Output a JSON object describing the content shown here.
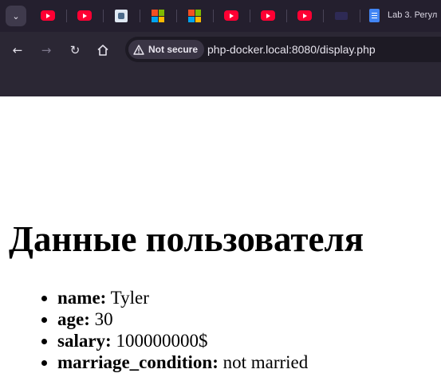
{
  "browser": {
    "active_tab": {
      "title": "Lab 3. Регул",
      "icon": "google-docs-icon"
    },
    "tab_icons": [
      "youtube-icon",
      "youtube-icon",
      "extension-icon",
      "microsoft-icon",
      "microsoft-icon",
      "youtube-icon",
      "youtube-icon",
      "youtube-icon",
      "dark-site-icon"
    ],
    "security_label": "Not secure",
    "url": "php-docker.local:8080/display.php"
  },
  "page": {
    "title": "Данные пользователя",
    "fields": [
      {
        "key": "name:",
        "value": " Tyler"
      },
      {
        "key": "age:",
        "value": " 30"
      },
      {
        "key": "salary:",
        "value": " 100000000$"
      },
      {
        "key": "marriage_condition:",
        "value": " not married"
      }
    ]
  },
  "colors": {
    "chrome_bg": "#2b2734",
    "tabstrip_bg": "#241f2e",
    "page_bg": "#ffffff",
    "youtube_red": "#ff0033"
  }
}
